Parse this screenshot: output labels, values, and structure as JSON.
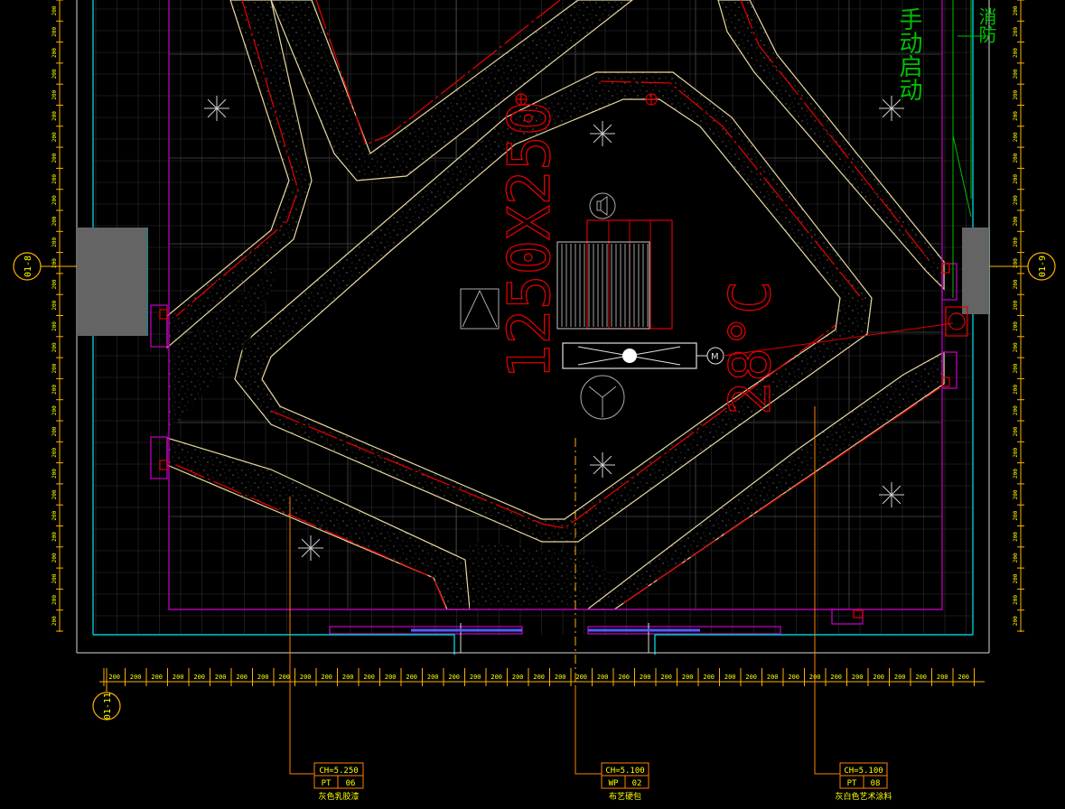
{
  "drawing": {
    "colors": {
      "background": "#000000",
      "grid": "#4a4a4a",
      "grid_fine": "#2e2e2e",
      "wall": "#b000b0",
      "cyan": "#00c8d8",
      "red": "#e00000",
      "path_edge": "#e8d8a0",
      "dim": "#ffb000",
      "dim_text": "#ffff00",
      "green": "#00c000",
      "leader": "#ff8000",
      "gray_block": "#646464",
      "white": "#d8d8d8"
    },
    "ruler_value": "200",
    "axis_markers": {
      "left": "01-8",
      "right": "01-9",
      "bottom": "01-11"
    },
    "tile_size_text": "1250X250",
    "temperature_text": "28°C",
    "fixtures": {
      "speaker_icon": "speaker-icon",
      "fan_symbol": "fan-coil-symbol",
      "motor_symbol_text": "M",
      "sprinkler_icon": "sprinkler-icon",
      "smoke_detector_icon": "smoke-detector-icon"
    },
    "green_annotation": "手动启动",
    "green_annotation_2": "消防",
    "ceiling_tags": [
      {
        "height": "CH=5.250",
        "code_a": "PT",
        "code_b": "06",
        "material": "灰色乳胶漆"
      },
      {
        "height": "CH=5.100",
        "code_a": "WP",
        "code_b": "02",
        "material": "布艺硬包"
      },
      {
        "height": "CH=5.100",
        "code_a": "PT",
        "code_b": "08",
        "material": "灰白色艺术涂料"
      }
    ]
  }
}
